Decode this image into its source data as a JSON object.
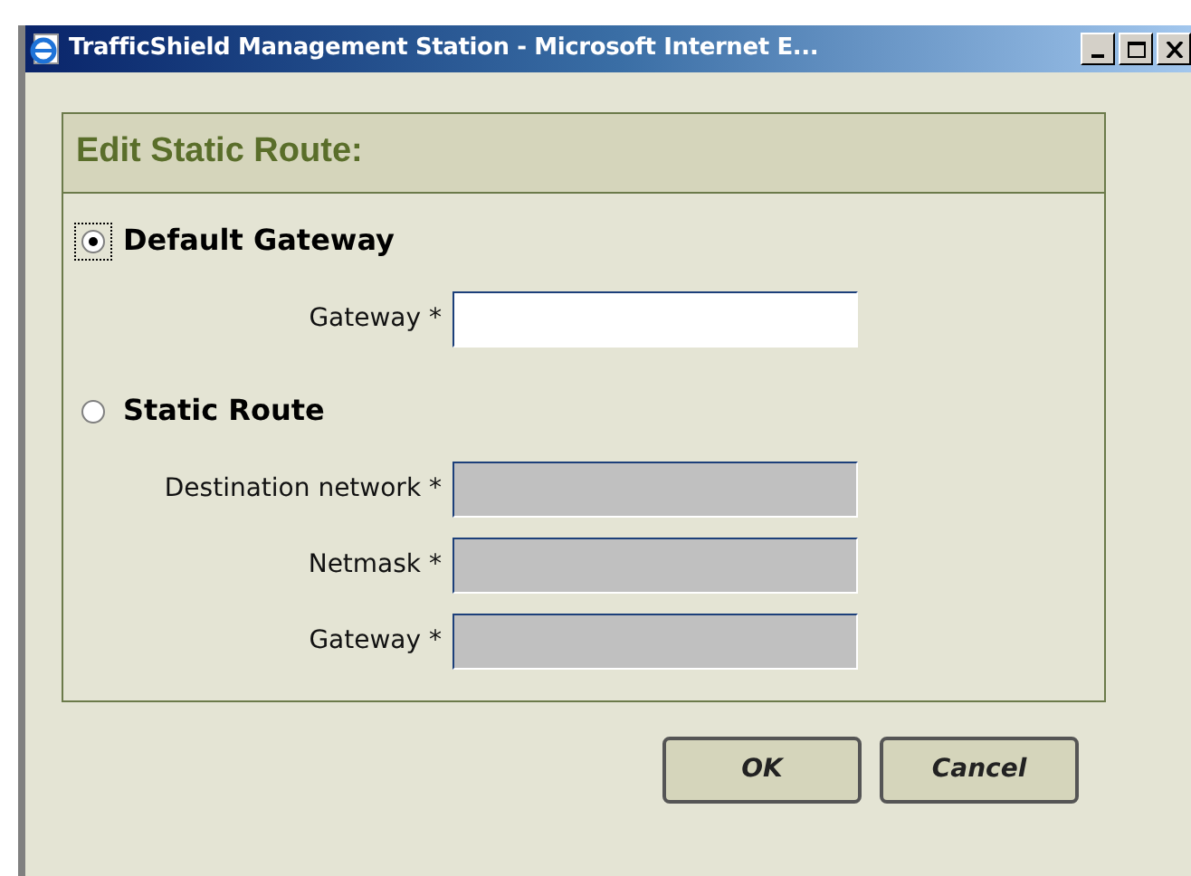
{
  "window": {
    "title": "TrafficShield Management Station - Microsoft Internet E..."
  },
  "panel": {
    "title": "Edit Static Route:"
  },
  "options": [
    {
      "label": "Default Gateway",
      "selected": true,
      "fields": [
        {
          "label": "Gateway *",
          "disabled": false
        }
      ]
    },
    {
      "label": "Static Route",
      "selected": false,
      "fields": [
        {
          "label": "Destination network *",
          "disabled": true
        },
        {
          "label": "Netmask *",
          "disabled": true
        },
        {
          "label": "Gateway *",
          "disabled": true
        }
      ]
    }
  ],
  "buttons": [
    "OK",
    "Cancel"
  ]
}
